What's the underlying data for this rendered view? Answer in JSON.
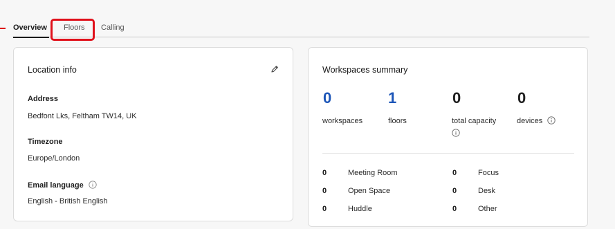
{
  "tabs": [
    {
      "label": "Overview",
      "active": true
    },
    {
      "label": "Floors",
      "active": false,
      "highlighted": true
    },
    {
      "label": "Calling",
      "active": false
    }
  ],
  "location_info": {
    "title": "Location info",
    "address_label": "Address",
    "address_value": "Bedfont Lks, Feltham TW14, UK",
    "timezone_label": "Timezone",
    "timezone_value": "Europe/London",
    "email_language_label": "Email language",
    "email_language_value": "English - British English"
  },
  "workspaces_summary": {
    "title": "Workspaces summary",
    "stats": [
      {
        "value": "0",
        "label": "workspaces",
        "color": "#1d56b8"
      },
      {
        "value": "1",
        "label": "floors",
        "color": "#1d56b8"
      },
      {
        "value": "0",
        "label": "total capacity",
        "color": "#1a1a1a"
      },
      {
        "value": "0",
        "label": "devices",
        "color": "#1a1a1a"
      }
    ],
    "types": [
      {
        "count": "0",
        "name": "Meeting Room"
      },
      {
        "count": "0",
        "name": "Focus"
      },
      {
        "count": "0",
        "name": "Open Space"
      },
      {
        "count": "0",
        "name": "Desk"
      },
      {
        "count": "0",
        "name": "Huddle"
      },
      {
        "count": "0",
        "name": "Other"
      }
    ]
  },
  "colors": {
    "accent": "#1d56b8",
    "highlight": "#e0101a"
  }
}
